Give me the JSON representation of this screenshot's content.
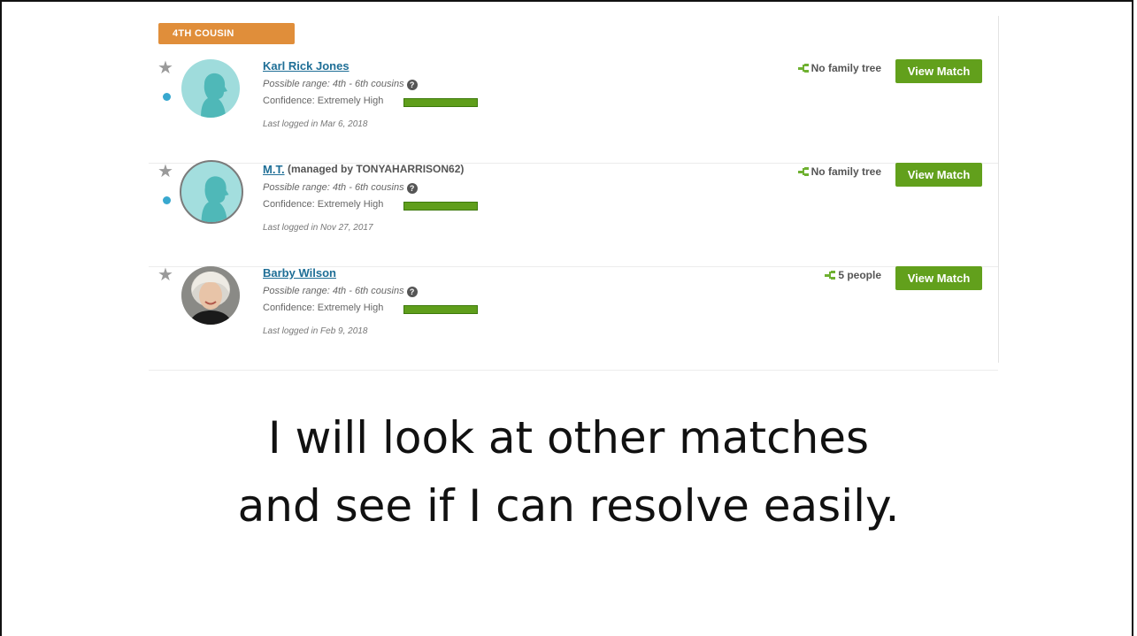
{
  "group_label": "4TH COUSIN",
  "matches": [
    {
      "name": "Karl Rick Jones",
      "managed_by": "",
      "range": "Possible range: 4th - 6th cousins",
      "confidence": "Confidence: Extremely High",
      "last_logged": "Last logged in Mar 6, 2018",
      "tree": "No family tree",
      "button": "View Match"
    },
    {
      "name": "M.T.",
      "managed_by": "(managed by TONYAHARRISON62)",
      "range": "Possible range: 4th - 6th cousins",
      "confidence": "Confidence: Extremely High",
      "last_logged": "Last logged in Nov 27, 2017",
      "tree": "No family tree",
      "button": "View Match"
    },
    {
      "name": "Barby Wilson",
      "managed_by": "",
      "range": "Possible range: 4th - 6th cousins",
      "confidence": "Confidence: Extremely High",
      "last_logged": "Last logged in Feb 9, 2018",
      "tree": "5 people",
      "button": "View Match"
    }
  ],
  "caption": {
    "line1": "I will look at other matches",
    "line2": "and see if I can resolve easily."
  },
  "colors": {
    "badge": "#e08e3a",
    "button": "#62a01c",
    "link": "#1e6e96",
    "dot": "#38a8cf"
  }
}
